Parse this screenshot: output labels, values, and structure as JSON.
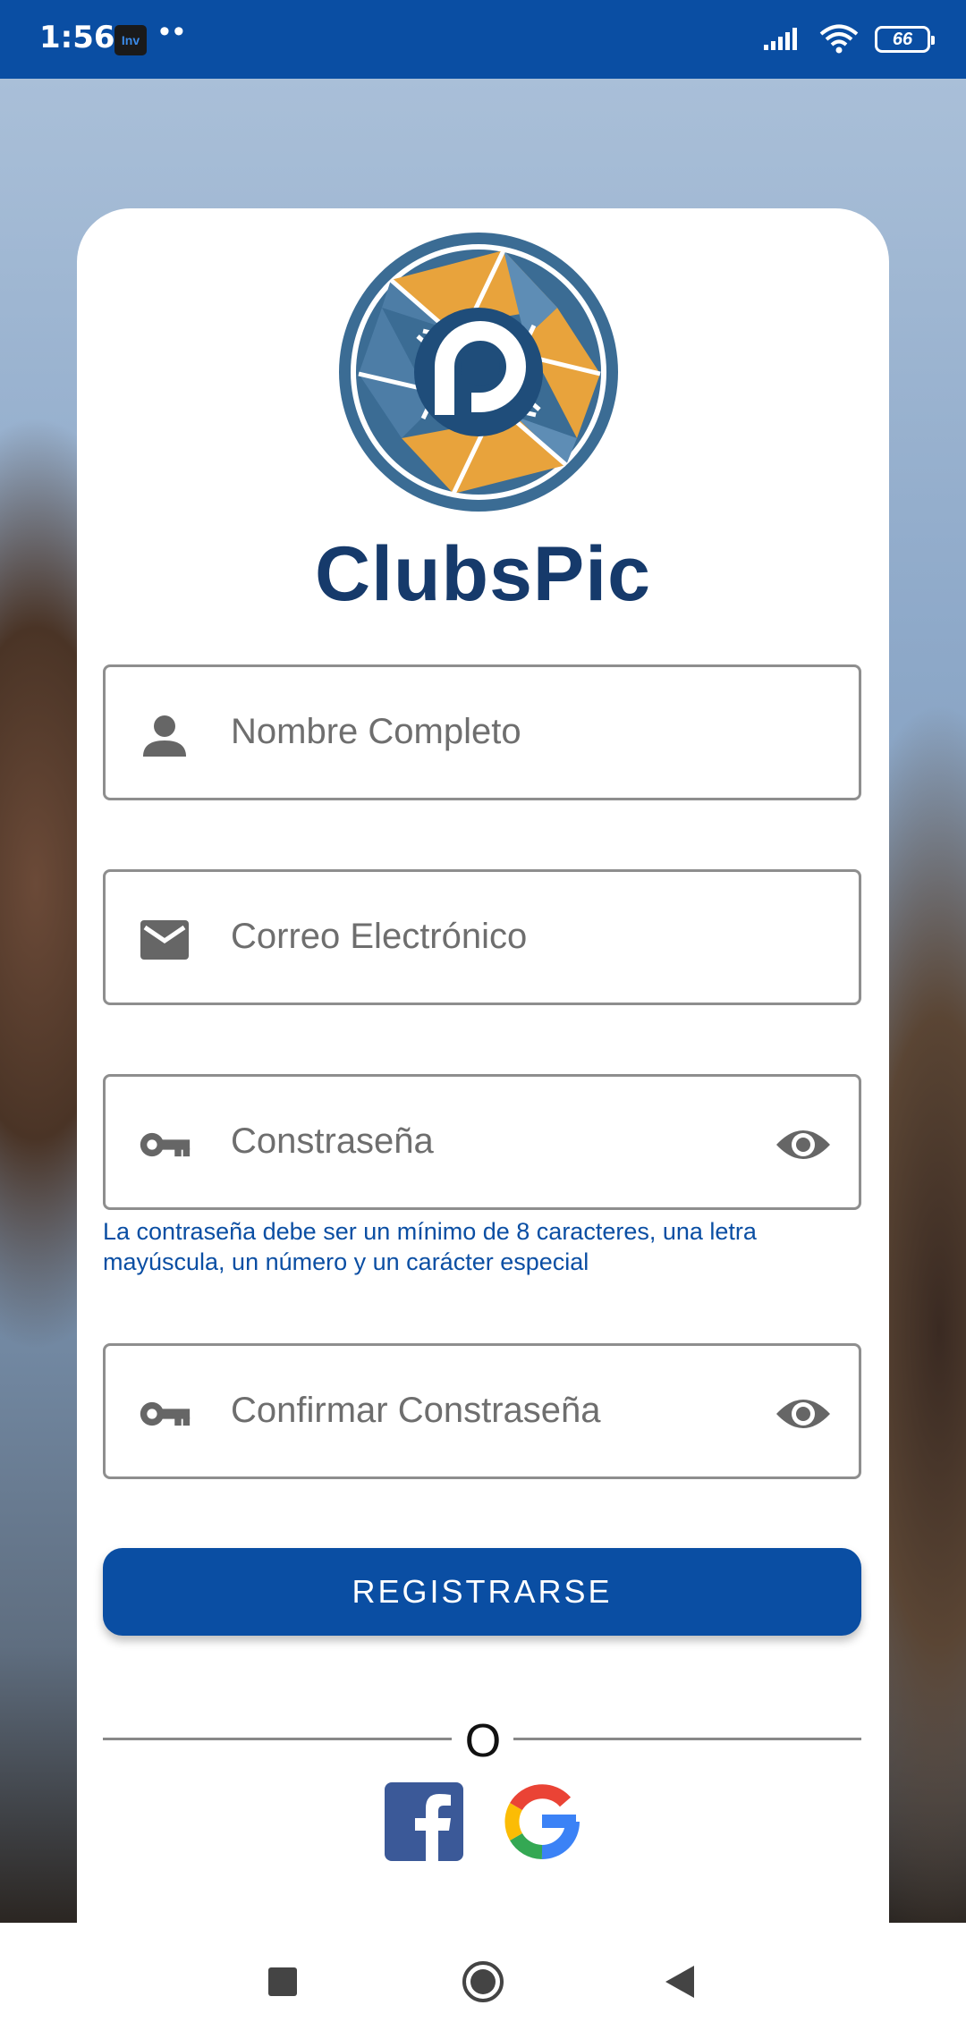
{
  "status_bar": {
    "time": "1:56",
    "app_badge": "Inv",
    "dots": "••",
    "battery": "66",
    "icons": [
      "signal-icon",
      "wifi-icon",
      "battery-icon"
    ]
  },
  "app": {
    "brand_name": "ClubsPic",
    "colors": {
      "primary": "#0a4ea3",
      "brand_text": "#163a6b",
      "logo_orange": "#e8a33c",
      "logo_blue": "#3b6c94"
    }
  },
  "form": {
    "full_name_placeholder": "Nombre Completo",
    "email_placeholder": "Correo Electrónico",
    "password_placeholder": "Constraseña",
    "password_hint": "La contraseña debe ser un mínimo de 8 caracteres, una letra mayúscula, un número y un carácter especial",
    "confirm_password_placeholder": "Confirmar Constraseña",
    "register_button": "REGISTRARSE",
    "or_label": "O"
  },
  "social": {
    "facebook": "facebook-icon",
    "google": "google-icon"
  },
  "navigation": {
    "buttons": [
      "recents-icon",
      "home-icon",
      "back-icon"
    ]
  }
}
